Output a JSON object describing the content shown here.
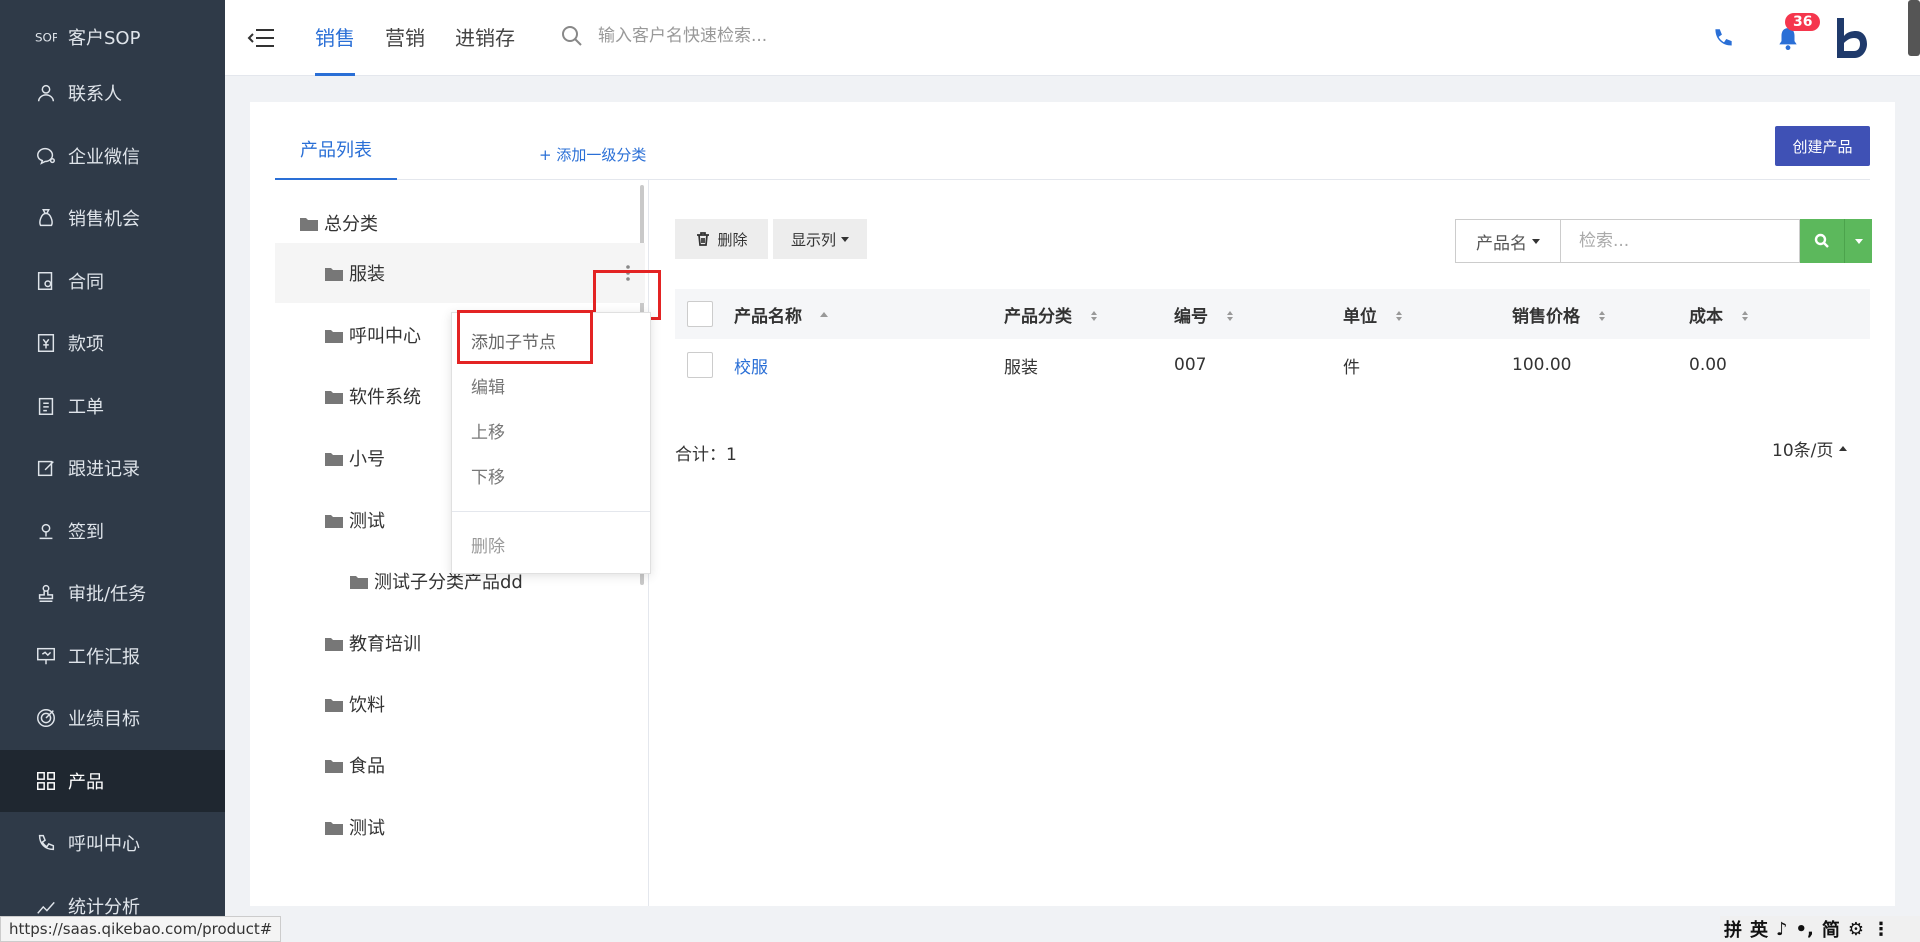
{
  "sidebar": {
    "items": [
      {
        "label": "客户SOP",
        "icon": "sop-icon"
      },
      {
        "label": "联系人",
        "icon": "contact-icon"
      },
      {
        "label": "企业微信",
        "icon": "wechat-icon"
      },
      {
        "label": "销售机会",
        "icon": "money-bag-icon"
      },
      {
        "label": "合同",
        "icon": "contract-icon"
      },
      {
        "label": "款项",
        "icon": "yen-icon"
      },
      {
        "label": "工单",
        "icon": "clipboard-icon"
      },
      {
        "label": "跟进记录",
        "icon": "edit-icon"
      },
      {
        "label": "签到",
        "icon": "location-icon"
      },
      {
        "label": "审批/任务",
        "icon": "stamp-icon"
      },
      {
        "label": "工作汇报",
        "icon": "presentation-icon"
      },
      {
        "label": "业绩目标",
        "icon": "target-icon"
      },
      {
        "label": "产品",
        "icon": "grid-icon"
      },
      {
        "label": "呼叫中心",
        "icon": "phone-call-icon"
      },
      {
        "label": "统计分析",
        "icon": "chart-icon"
      }
    ],
    "active_index": 12
  },
  "header": {
    "tabs": [
      "销售",
      "营销",
      "进销存"
    ],
    "active_tab": 0,
    "search_placeholder": "输入客户名快速检索...",
    "notification_count": "36"
  },
  "card": {
    "tab_label": "产品列表",
    "add_category": "+ 添加一级分类",
    "create_button": "创建产品"
  },
  "tree": {
    "nodes": [
      {
        "label": "总分类",
        "level": 0
      },
      {
        "label": "服装",
        "level": 1
      },
      {
        "label": "呼叫中心",
        "level": 1
      },
      {
        "label": "软件系统",
        "level": 1
      },
      {
        "label": "小号",
        "level": 1
      },
      {
        "label": "测试",
        "level": 1
      },
      {
        "label": "测试子分类产品dd",
        "level": 2
      },
      {
        "label": "教育培训",
        "level": 1
      },
      {
        "label": "饮料",
        "level": 1
      },
      {
        "label": "食品",
        "level": 1
      },
      {
        "label": "测试",
        "level": 1
      }
    ]
  },
  "context_menu": {
    "items": [
      "添加子节点",
      "编辑",
      "上移",
      "下移",
      "删除"
    ]
  },
  "toolbar": {
    "delete_label": "删除",
    "columns_label": "显示列",
    "search_field": "产品名",
    "search_placeholder": "检索..."
  },
  "table": {
    "columns": [
      "产品名称",
      "产品分类",
      "编号",
      "单位",
      "销售价格",
      "成本"
    ],
    "rows": [
      {
        "name": "校服",
        "category": "服装",
        "code": "007",
        "unit": "件",
        "price": "100.00",
        "cost": "0.00"
      }
    ]
  },
  "footer": {
    "total": "合计：1",
    "page_size": "10条/页"
  },
  "statusbar": {
    "url": "https://saas.qikebao.com/product#"
  },
  "ime": {
    "glyphs": [
      "拼",
      "英",
      "♪",
      "•,",
      "简",
      "⚙",
      "⋮"
    ]
  },
  "colors": {
    "sidebar_bg": "#2f3a48",
    "accent": "#2a6fd6",
    "create_button": "#3f51b5",
    "search_button": "#5cb85c",
    "badge": "#f5364d",
    "highlight_box": "#e32323"
  }
}
